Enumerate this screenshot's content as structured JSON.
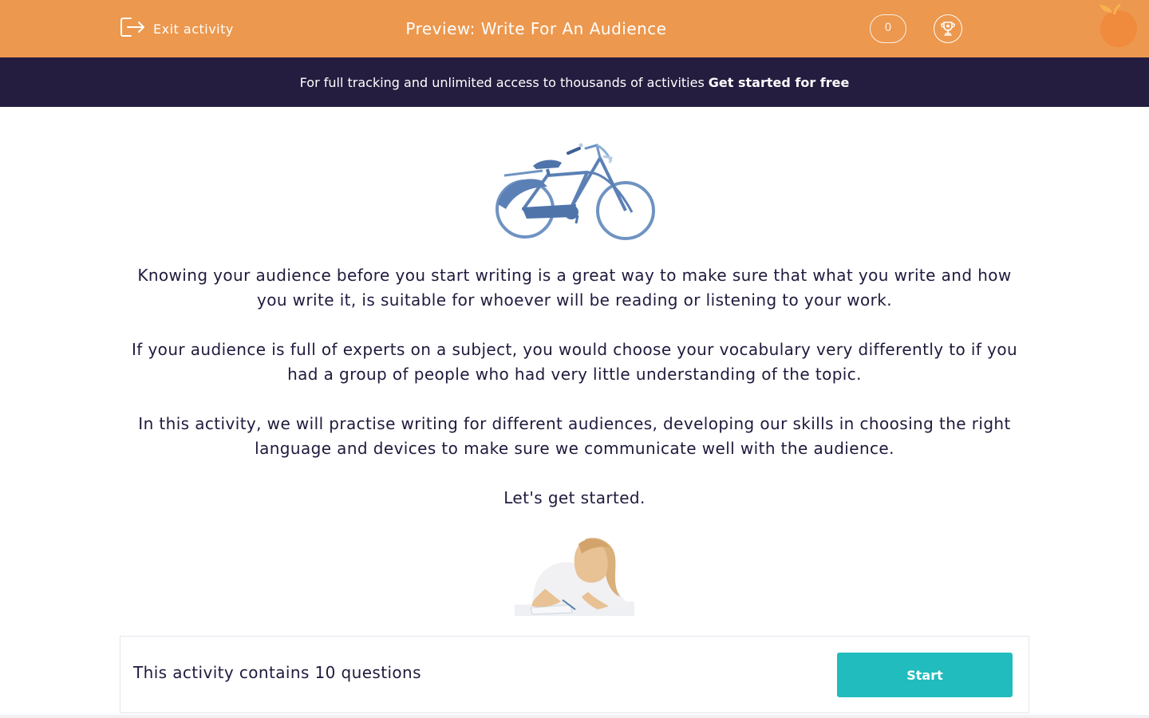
{
  "header": {
    "exit_label": "Exit activity",
    "title": "Preview: Write For An Audience",
    "score": "0",
    "colors": {
      "bar": "#ec984e"
    }
  },
  "banner": {
    "text": "For full tracking and unlimited access to thousands of activities",
    "cta": "Get started for free",
    "colors": {
      "background": "#251d3f"
    }
  },
  "intro": {
    "images": [
      "bicycle-illustration",
      "girl-writing-photo"
    ],
    "paragraphs": [
      "Knowing your audience before you start writing is a great way to make sure that what you write and how you write it, is suitable for whoever will be reading or listening to your work.",
      "If your audience is full of experts on a subject, you would choose your vocabulary very differently to if you had a group of people who had very little understanding of the topic.",
      "In this activity, we will practise writing for different audiences, developing our skills in choosing the right language and devices to make sure we communicate well with the audience.",
      "Let's get started."
    ]
  },
  "footer": {
    "question_count_text": "This activity contains 10 questions",
    "start_label": "Start",
    "colors": {
      "start_button": "#21bcbe"
    }
  }
}
